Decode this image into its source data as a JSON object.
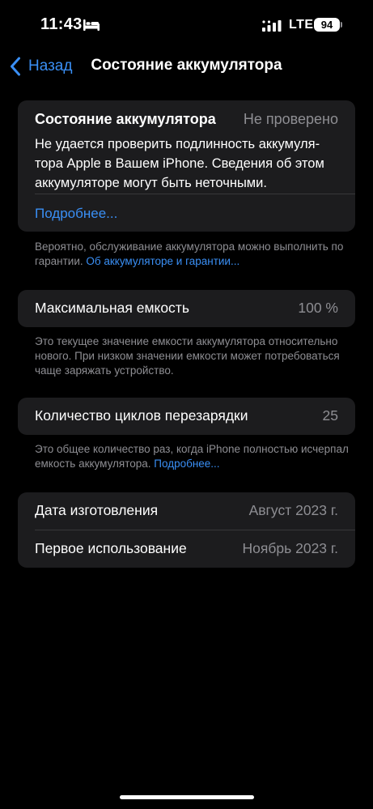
{
  "status_bar": {
    "time": "11:43",
    "network": "LTE",
    "battery_level": "94",
    "icons": [
      "bed-icon",
      "signal-icon",
      "battery-icon"
    ]
  },
  "nav": {
    "back_label": "Назад",
    "title": "Состояние аккумулятора"
  },
  "health": {
    "title": "Состояние аккумулятора",
    "status": "Не проверено",
    "warning": "Не удается проверить подлинность аккумуля-\nтора Apple в Вашем iPhone. Сведения об этом\nаккумуляторе могут быть неточными.",
    "more_link": "Подробнее...",
    "footnote_text": "Вероятно, обслуживание аккумулятора можно выполнить по гарантии. ",
    "footnote_link": "Об аккумуляторе и гарантии..."
  },
  "capacity": {
    "label": "Максимальная емкость",
    "value": "100 %",
    "footnote": "Это текущее значение емкости аккумулятора относительно нового. При низком значении емкости может потребоваться чаще заряжать устройство."
  },
  "cycles": {
    "label": "Количество циклов перезарядки",
    "value": "25",
    "footnote_text": "Это общее количество раз, когда iPhone полностью исчерпал емкость аккумулятора. ",
    "footnote_link": "Подробнее..."
  },
  "dates": {
    "manufacture_label": "Дата изготовления",
    "manufacture_value": "Август 2023 г.",
    "first_use_label": "Первое использование",
    "first_use_value": "Ноябрь 2023 г."
  },
  "colors": {
    "background": "#000000",
    "card": "#1c1c1e",
    "accent": "#3a8ff5",
    "secondary_text": "#8e8e93"
  }
}
